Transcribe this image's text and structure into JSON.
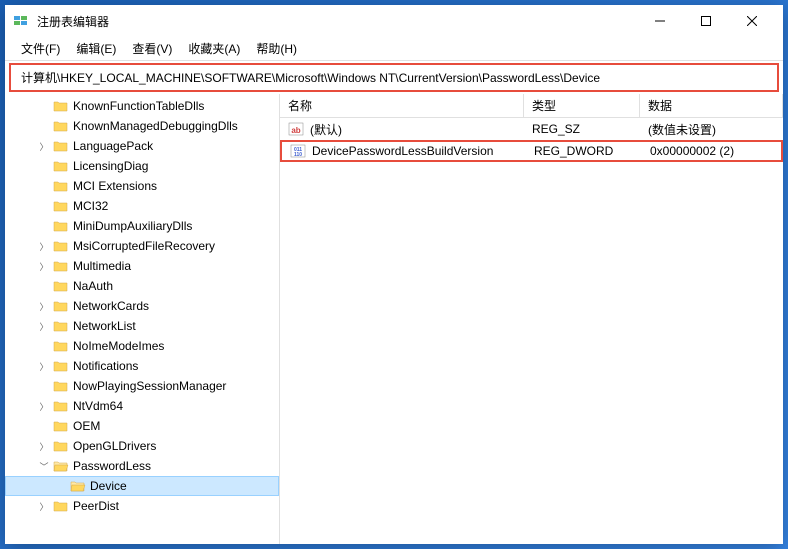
{
  "window": {
    "title": "注册表编辑器"
  },
  "menu": {
    "file": "文件(F)",
    "edit": "编辑(E)",
    "view": "查看(V)",
    "favorites": "收藏夹(A)",
    "help": "帮助(H)"
  },
  "address": "计算机\\HKEY_LOCAL_MACHINE\\SOFTWARE\\Microsoft\\Windows NT\\CurrentVersion\\PasswordLess\\Device",
  "tree": [
    {
      "label": "KnownFunctionTableDlls",
      "indent": 2,
      "chevron": ""
    },
    {
      "label": "KnownManagedDebuggingDlls",
      "indent": 2,
      "chevron": ""
    },
    {
      "label": "LanguagePack",
      "indent": 2,
      "chevron": ">"
    },
    {
      "label": "LicensingDiag",
      "indent": 2,
      "chevron": ""
    },
    {
      "label": "MCI Extensions",
      "indent": 2,
      "chevron": ""
    },
    {
      "label": "MCI32",
      "indent": 2,
      "chevron": ""
    },
    {
      "label": "MiniDumpAuxiliaryDlls",
      "indent": 2,
      "chevron": ""
    },
    {
      "label": "MsiCorruptedFileRecovery",
      "indent": 2,
      "chevron": ">"
    },
    {
      "label": "Multimedia",
      "indent": 2,
      "chevron": ">"
    },
    {
      "label": "NaAuth",
      "indent": 2,
      "chevron": ""
    },
    {
      "label": "NetworkCards",
      "indent": 2,
      "chevron": ">"
    },
    {
      "label": "NetworkList",
      "indent": 2,
      "chevron": ">"
    },
    {
      "label": "NoImeModeImes",
      "indent": 2,
      "chevron": ""
    },
    {
      "label": "Notifications",
      "indent": 2,
      "chevron": ">"
    },
    {
      "label": "NowPlayingSessionManager",
      "indent": 2,
      "chevron": ""
    },
    {
      "label": "NtVdm64",
      "indent": 2,
      "chevron": ">"
    },
    {
      "label": "OEM",
      "indent": 2,
      "chevron": ""
    },
    {
      "label": "OpenGLDrivers",
      "indent": 2,
      "chevron": ">"
    },
    {
      "label": "PasswordLess",
      "indent": 2,
      "chevron": "v",
      "expanded": true
    },
    {
      "label": "Device",
      "indent": 3,
      "chevron": "",
      "selected": true
    },
    {
      "label": "PeerDist",
      "indent": 2,
      "chevron": ">"
    }
  ],
  "columns": {
    "name": "名称",
    "type": "类型",
    "data": "数据"
  },
  "values": [
    {
      "name": "(默认)",
      "type": "REG_SZ",
      "data": "(数值未设置)",
      "icon": "string",
      "highlighted": false
    },
    {
      "name": "DevicePasswordLessBuildVersion",
      "type": "REG_DWORD",
      "data": "0x00000002 (2)",
      "icon": "binary",
      "highlighted": true
    }
  ]
}
